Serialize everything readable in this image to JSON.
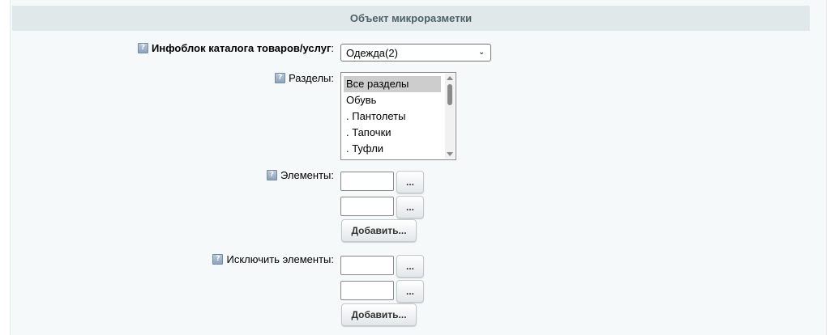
{
  "section": {
    "title": "Объект микроразметки"
  },
  "help_icon_glyph": "?",
  "fields": {
    "infoblock": {
      "label": "Инфоблок каталога товаров/услуг",
      "colon": ":",
      "selected": "Одежда(2)",
      "chevron": "⌄"
    },
    "sections": {
      "label": "Разделы:",
      "items": [
        "Все разделы",
        "Обувь",
        ". Пантолеты",
        ". Тапочки",
        ". Туфли"
      ],
      "selected_index": 0
    },
    "elements": {
      "label": "Элементы:",
      "inputs": [
        "",
        ""
      ],
      "browse_label": "...",
      "add_label": "Добавить..."
    },
    "exclude_elements": {
      "label": "Исключить элементы:",
      "inputs": [
        "",
        ""
      ],
      "browse_label": "...",
      "add_label": "Добавить..."
    }
  }
}
